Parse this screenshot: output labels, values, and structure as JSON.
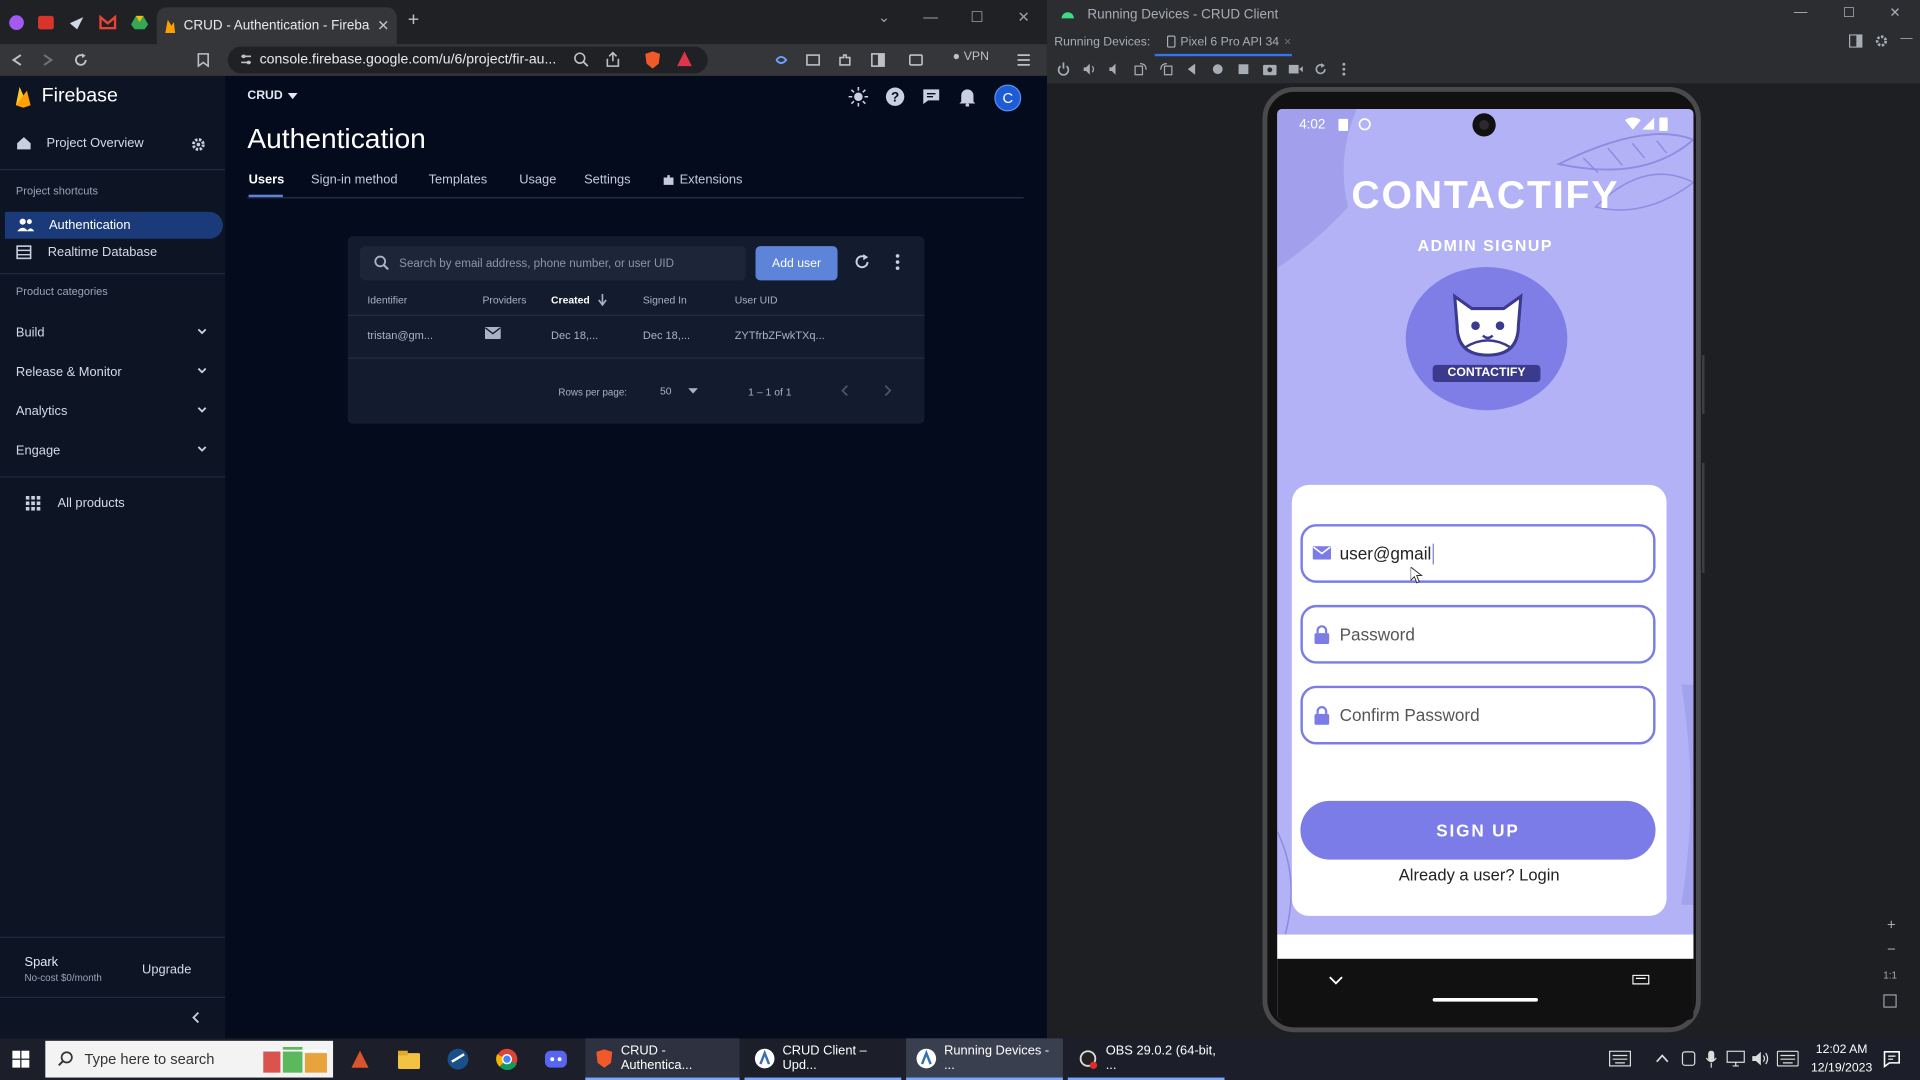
{
  "browser": {
    "active_tab_title": "CRUD - Authentication - Firebase",
    "url": "console.firebase.google.com/u/6/project/fir-au...",
    "vpn_label": "VPN"
  },
  "firebase": {
    "brand": "Firebase",
    "project_overview": "Project Overview",
    "project_shortcuts": "Project shortcuts",
    "shortcuts": [
      "Authentication",
      "Realtime Database"
    ],
    "product_categories": "Product categories",
    "categories": [
      "Build",
      "Release & Monitor",
      "Analytics",
      "Engage"
    ],
    "all_products": "All products",
    "plan_name": "Spark",
    "plan_desc": "No-cost $0/month",
    "upgrade": "Upgrade",
    "project_name": "CRUD",
    "avatar_letter": "C",
    "page_title": "Authentication",
    "tabs": [
      "Users",
      "Sign-in method",
      "Templates",
      "Usage",
      "Settings",
      "Extensions"
    ],
    "search_placeholder": "Search by email address, phone number, or user UID",
    "add_user": "Add user",
    "columns": [
      "Identifier",
      "Providers",
      "Created",
      "Signed In",
      "User UID"
    ],
    "rows": [
      {
        "identifier": "tristan@gm...",
        "created": "Dec 18,...",
        "signed_in": "Dec 18,...",
        "uid": "ZYTfrbZFwkTXq..."
      }
    ],
    "rows_per_page_label": "Rows per page:",
    "rows_per_page": "50",
    "pagination": "1 – 1 of 1"
  },
  "studio": {
    "window_title": "Running Devices - CRUD Client",
    "running_devices_label": "Running Devices:",
    "device_tab": "Pixel 6 Pro API 34"
  },
  "phone": {
    "time": "4:02",
    "app_title": "CONTACTIFY",
    "subtitle": "ADMIN SIGNUP",
    "logo_text": "CONTACTIFY",
    "email_value": "user@gmail",
    "password_placeholder": "Password",
    "confirm_placeholder": "Confirm Password",
    "signup_button": "SIGN UP",
    "login_link": "Already a user? Login"
  },
  "taskbar": {
    "search_placeholder": "Type here to search",
    "apps": [
      "CRUD - Authentica...",
      "CRUD Client – Upd...",
      "Running Devices - ...",
      "OBS 29.0.2 (64-bit, ..."
    ],
    "time": "12:02 AM",
    "date": "12/19/2023"
  }
}
